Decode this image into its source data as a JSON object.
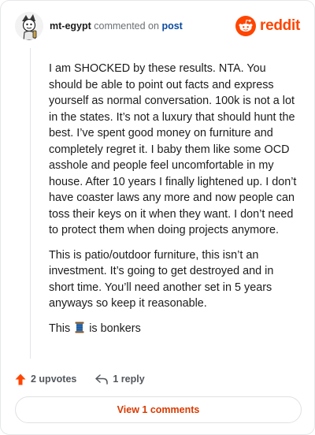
{
  "header": {
    "username": "mt-egypt",
    "commented_on": "commented on",
    "post_link": "post",
    "brand": "reddit"
  },
  "comment": {
    "paragraphs": [
      "I am SHOCKED by these results. NTA. You should be able to point out facts and express yourself as normal conversation. 100k is not a lot in the states. It’s not a luxury that should hunt the best. I’ve spent good money on furniture and completely regret it. I baby them like some OCD asshole and people feel uncomfortable in my house. After 10 years I finally lightened up. I don’t have coaster laws any more and now people can toss their keys on it when they want. I don’t need to protect them when doing projects anymore.",
      "This is patio/outdoor furniture, this isn’t an investment. It’s going to get destroyed and in short time. You’ll need another set in 5 years anyways so keep it reasonable."
    ],
    "last_before": "This",
    "last_after": "is bonkers",
    "emoji_icon": "spool-of-thread-emoji"
  },
  "actions": {
    "upvotes": "2 upvotes",
    "replies": "1 reply"
  },
  "footer": {
    "view_comments": "View 1 comments"
  },
  "colors": {
    "brand_orange": "#ff4500",
    "link_blue": "#0a4a9e",
    "button_text": "#d93a00"
  }
}
